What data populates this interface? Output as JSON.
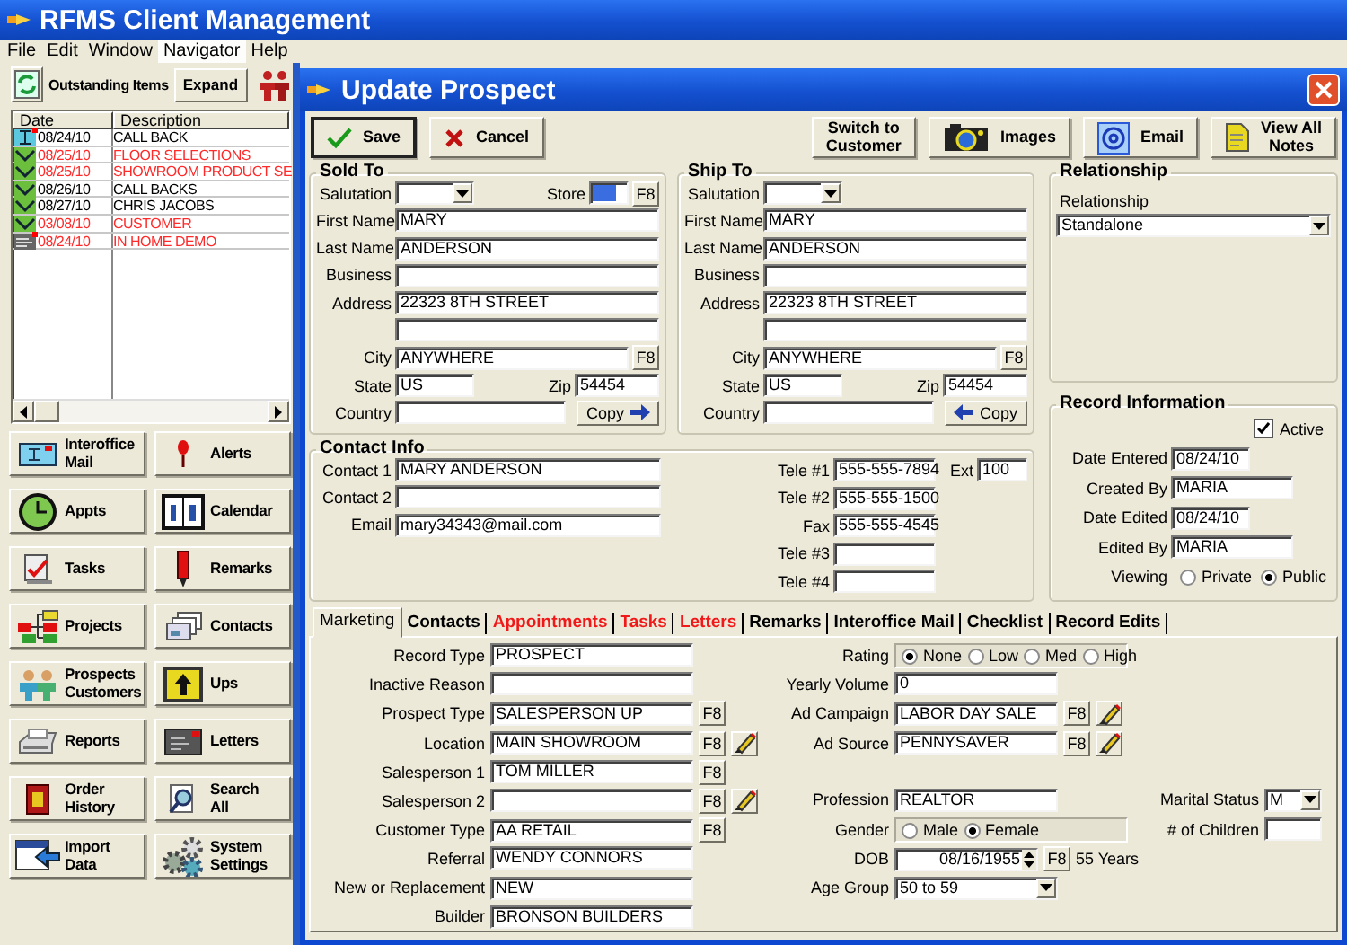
{
  "app": {
    "title": "RFMS Client Management",
    "menu": [
      {
        "label": "File",
        "selected": false
      },
      {
        "label": "Edit",
        "selected": false
      },
      {
        "label": "Window",
        "selected": false
      },
      {
        "label": "Navigator",
        "selected": true
      },
      {
        "label": "Help",
        "selected": false
      }
    ]
  },
  "outstanding": {
    "title": "Outstanding Items",
    "expand": "Expand",
    "columns": [
      "Date",
      "Description"
    ],
    "rows": [
      {
        "date": "08/24/10",
        "description": "CALL BACK",
        "kind": "call",
        "flagged": true,
        "overdue": false
      },
      {
        "date": "08/25/10",
        "description": "FLOOR SELECTIONS",
        "kind": "task",
        "flagged": false,
        "overdue": true
      },
      {
        "date": "08/25/10",
        "description": "SHOWROOM PRODUCT SE",
        "kind": "task",
        "flagged": false,
        "overdue": true
      },
      {
        "date": "08/26/10",
        "description": "CALL BACKS",
        "kind": "task",
        "flagged": false,
        "overdue": false
      },
      {
        "date": "08/27/10",
        "description": "CHRIS JACOBS",
        "kind": "task",
        "flagged": false,
        "overdue": false
      },
      {
        "date": "03/08/10",
        "description": "CUSTOMER",
        "kind": "task",
        "flagged": false,
        "overdue": true
      },
      {
        "date": "08/24/10",
        "description": "IN HOME DEMO",
        "kind": "note",
        "flagged": true,
        "overdue": true
      }
    ]
  },
  "navigator": [
    {
      "label": "Interoffice\nMail",
      "kind": "mail"
    },
    {
      "label": "Alerts",
      "kind": "alert"
    },
    {
      "label": "Appts",
      "kind": "clock"
    },
    {
      "label": "Calendar",
      "kind": "calendar"
    },
    {
      "label": "Tasks",
      "kind": "tasks"
    },
    {
      "label": "Remarks",
      "kind": "marker"
    },
    {
      "label": "Projects",
      "kind": "projects"
    },
    {
      "label": "Contacts",
      "kind": "cards"
    },
    {
      "label": "Prospects\nCustomers",
      "kind": "people"
    },
    {
      "label": "Ups",
      "kind": "ups"
    },
    {
      "label": "Reports",
      "kind": "printer"
    },
    {
      "label": "Letters",
      "kind": "letter"
    },
    {
      "label": "Order\nHistory",
      "kind": "book"
    },
    {
      "label": "Search\nAll",
      "kind": "search"
    },
    {
      "label": "Import\nData",
      "kind": "import"
    },
    {
      "label": "System\nSettings",
      "kind": "gears"
    }
  ],
  "dialog": {
    "title": "Update Prospect",
    "actions": [
      {
        "label": "Save",
        "kind": "save"
      },
      {
        "label": "Cancel",
        "kind": "cancel"
      }
    ],
    "tools": [
      {
        "label": "Switch to\nCustomer",
        "kind": "text"
      },
      {
        "label": "Images",
        "kind": "camera"
      },
      {
        "label": "Email",
        "kind": "email"
      },
      {
        "label": "View All\nNotes",
        "kind": "notes"
      }
    ],
    "sold_to": {
      "title": "Sold To",
      "salutation": "Salutation",
      "store": "Store",
      "store_button": "F8",
      "first_name": {
        "label": "First Name",
        "value": "MARY"
      },
      "last_name": {
        "label": "Last Name",
        "value": "ANDERSON"
      },
      "business": {
        "label": "Business"
      },
      "address": {
        "label": "Address",
        "value": "22323 8TH STREET"
      },
      "city": {
        "label": "City",
        "value": "ANYWHERE",
        "button": "F8"
      },
      "state": {
        "label": "State",
        "value": "US"
      },
      "zip": {
        "label": "Zip",
        "value": "54454"
      },
      "country": {
        "label": "Country"
      },
      "copy": "Copy"
    },
    "ship_to": {
      "title": "Ship To",
      "salutation": "Salutation",
      "first_name": {
        "label": "First Name",
        "value": "MARY"
      },
      "last_name": {
        "label": "Last Name",
        "value": "ANDERSON"
      },
      "business": {
        "label": "Business"
      },
      "address": {
        "label": "Address",
        "value": "22323 8TH STREET"
      },
      "city": {
        "label": "City",
        "value": "ANYWHERE",
        "button": "F8"
      },
      "state": {
        "label": "State",
        "value": "US"
      },
      "zip": {
        "label": "Zip",
        "value": "54454"
      },
      "country": {
        "label": "Country"
      },
      "copy": "Copy"
    },
    "contact_info": {
      "title": "Contact Info",
      "contacts": [
        {
          "label": "Contact 1",
          "value": "MARY ANDERSON"
        },
        {
          "label": "Contact 2"
        },
        {
          "label": "Email",
          "value": "mary34343@mail.com"
        }
      ],
      "phones": [
        {
          "label": "Tele #1",
          "value": "555-555-7894"
        },
        {
          "label": "Tele #2",
          "value": "555-555-1500"
        },
        {
          "label": "Fax",
          "value": "555-555-4545"
        },
        {
          "label": "Tele #3"
        },
        {
          "label": "Tele #4"
        }
      ],
      "ext": {
        "label": "Ext",
        "value": "100"
      }
    },
    "relationship": {
      "title": "Relationship",
      "label": "Relationship",
      "value": "Standalone"
    },
    "record_info": {
      "title": "Record Information",
      "active": {
        "label": "Active",
        "checked": true
      },
      "fields": [
        {
          "label": "Date Entered",
          "value": "08/24/10",
          "kind": "date"
        },
        {
          "label": "Created By",
          "value": "MARIA",
          "kind": "text"
        },
        {
          "label": "Date Edited",
          "value": "08/24/10",
          "kind": "date"
        },
        {
          "label": "Edited By",
          "value": "MARIA",
          "kind": "text"
        }
      ],
      "viewing": {
        "label": "Viewing",
        "options": [
          {
            "label": "Private",
            "selected": false
          },
          {
            "label": "Public",
            "selected": true
          }
        ]
      }
    },
    "tabs": [
      {
        "label": "Marketing",
        "selected": true,
        "highlighted": false
      },
      {
        "label": "Contacts",
        "selected": false,
        "highlighted": false
      },
      {
        "label": "Appointments",
        "selected": false,
        "highlighted": true
      },
      {
        "label": "Tasks",
        "selected": false,
        "highlighted": true
      },
      {
        "label": "Letters",
        "selected": false,
        "highlighted": true
      },
      {
        "label": "Remarks",
        "selected": false,
        "highlighted": false
      },
      {
        "label": "Interoffice Mail",
        "selected": false,
        "highlighted": false
      },
      {
        "label": "Checklist",
        "selected": false,
        "highlighted": false
      },
      {
        "label": "Record Edits",
        "selected": false,
        "highlighted": false
      }
    ],
    "marketing": {
      "left": [
        {
          "kind": "text",
          "label": "Record Type",
          "value": "PROSPECT"
        },
        {
          "kind": "text",
          "label": "Inactive Reason"
        },
        {
          "kind": "text",
          "label": "Prospect Type",
          "value": "SALESPERSON UP",
          "button": "F8"
        },
        {
          "kind": "text",
          "label": "Location",
          "value": "MAIN SHOWROOM",
          "button": "F8",
          "edit": true
        },
        {
          "kind": "text",
          "label": "Salesperson 1",
          "value": "TOM MILLER",
          "button": "F8"
        },
        {
          "kind": "text",
          "label": "Salesperson 2",
          "button": "F8",
          "edit": true
        },
        {
          "kind": "text",
          "label": "Customer Type",
          "value": "AA RETAIL",
          "button": "F8"
        },
        {
          "kind": "text",
          "label": "Referral",
          "value": "WENDY CONNORS"
        },
        {
          "kind": "text",
          "label": "New or Replacement",
          "value": "NEW"
        },
        {
          "kind": "text",
          "label": "Builder",
          "value": "BRONSON BUILDERS"
        }
      ],
      "campaign": [
        {
          "kind": "radio",
          "label": "Rating",
          "options": [
            {
              "label": "None",
              "selected": true
            },
            {
              "label": "Low",
              "selected": false
            },
            {
              "label": "Med",
              "selected": false
            },
            {
              "label": "High",
              "selected": false
            }
          ]
        },
        {
          "kind": "text",
          "label": "Yearly Volume",
          "value": "0"
        },
        {
          "kind": "text",
          "label": "Ad Campaign",
          "value": "LABOR DAY SALE",
          "button": "F8",
          "edit": true
        },
        {
          "kind": "text",
          "label": "Ad Source",
          "value": "PENNYSAVER",
          "button": "F8",
          "edit": true
        }
      ],
      "personal": [
        {
          "kind": "text",
          "label": "Profession",
          "value": "REALTOR"
        },
        {
          "kind": "radio",
          "label": "Gender",
          "options": [
            {
              "label": "Male",
              "selected": false
            },
            {
              "label": "Female",
              "selected": true
            }
          ]
        },
        {
          "kind": "date",
          "label": "DOB",
          "value": "08/16/1955",
          "button": "F8",
          "note": "55 Years"
        },
        {
          "kind": "select",
          "label": "Age Group",
          "value": "50 to 59"
        }
      ],
      "family": [
        {
          "kind": "select",
          "label": "Marital Status",
          "value": "M"
        },
        {
          "kind": "text",
          "label": "# of Children"
        }
      ]
    }
  }
}
